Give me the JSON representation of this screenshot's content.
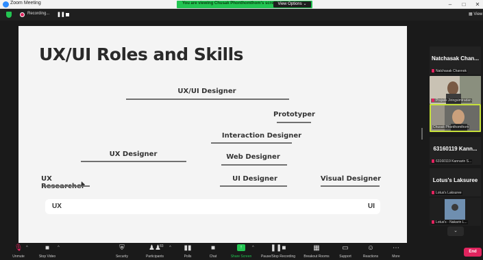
{
  "window": {
    "title": "Zoom Meeting",
    "share_banner": "You are viewing Chusak Phonthomthom's screen",
    "view_options": "View Options ⌄"
  },
  "recording": {
    "label": "Recording...",
    "view_label": "View"
  },
  "slide": {
    "title": "UX/UI Roles and Skills",
    "roles": {
      "ux_ui_designer": "UX/UI Designer",
      "prototyper": "Prototyper",
      "interaction_designer": "Interaction Designer",
      "ux_designer": "UX Designer",
      "web_designer": "Web Designer",
      "ux_researcher": "UX Researcher",
      "ui_designer": "UI Designer",
      "visual_designer": "Visual Designer"
    },
    "axis": {
      "left": "UX",
      "right": "UI"
    }
  },
  "participants": [
    {
      "display": "Natchasak Chan...",
      "caption": "Natchasak Channok",
      "video": false
    },
    {
      "display": "",
      "caption": "Prajakk Jiringsimtradan",
      "video": true
    },
    {
      "display": "",
      "caption": "Chusak Phonthomthom",
      "video": true,
      "active": true
    },
    {
      "display": "63160119 Kann...",
      "caption": "63160119 Kannarin S...",
      "video": false
    },
    {
      "display": "Lotus's Laksuree",
      "caption": "Lotus's Laksuree",
      "video": false
    },
    {
      "display": "",
      "caption": "Lotus's - Nakarin L...",
      "video": true
    }
  ],
  "toolbar": {
    "unmute": "Unmute",
    "stop_video": "Stop Video",
    "security": "Security",
    "participants": "Participants",
    "participants_count": "83",
    "polls": "Polls",
    "chat": "Chat",
    "share_screen": "Share Screen",
    "pause_stop_recording": "Pause/Stop Recording",
    "breakout_rooms": "Breakout Rooms",
    "support": "Support",
    "reactions": "Reactions",
    "more": "More",
    "end": "End"
  }
}
